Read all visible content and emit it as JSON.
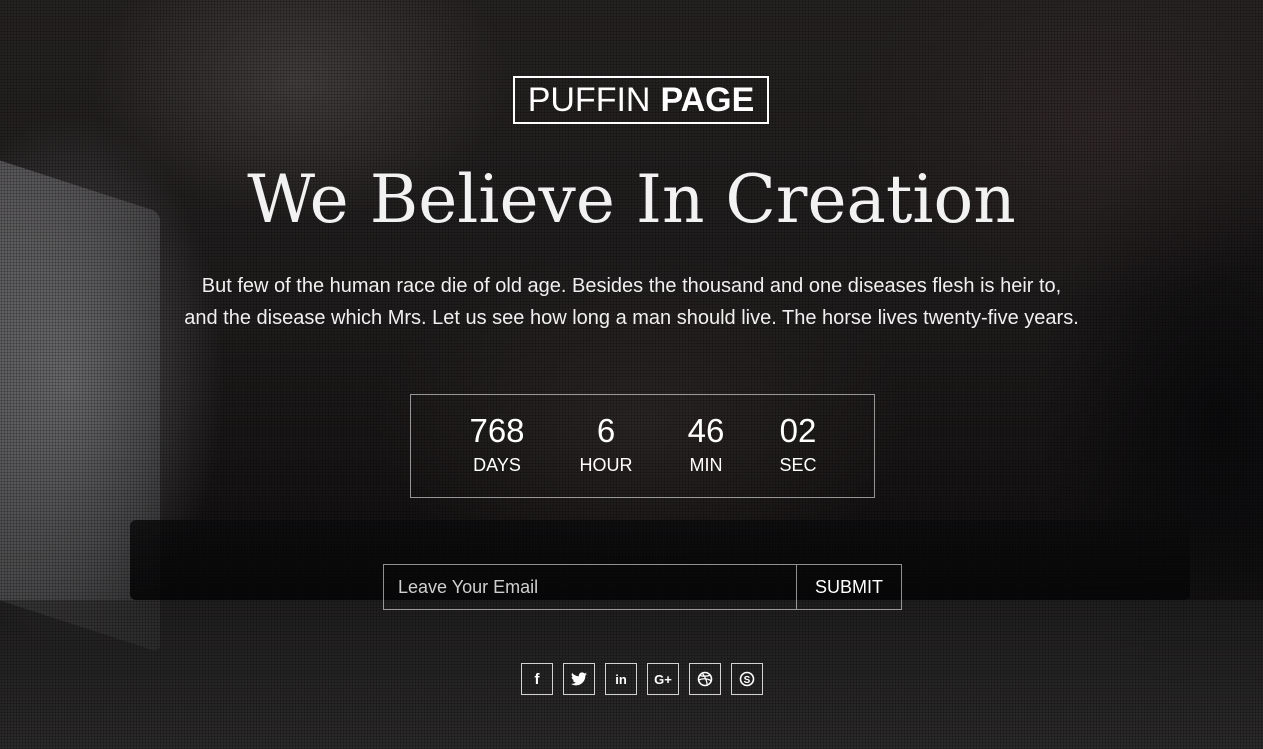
{
  "logo": {
    "light": "PUFFIN",
    "bold": "PAGE"
  },
  "hero": {
    "headline": "We Believe In Creation",
    "description_line1": "But few of the human race die of old age. Besides the thousand and one diseases flesh is heir to,",
    "description_line2": "and the disease which Mrs. Let us see how long a man should live. The horse lives twenty-five years."
  },
  "countdown": {
    "units": [
      {
        "value": "768",
        "label": "DAYS"
      },
      {
        "value": "6",
        "label": "HOUR"
      },
      {
        "value": "46",
        "label": "MIN"
      },
      {
        "value": "02",
        "label": "SEC"
      }
    ]
  },
  "subscribe": {
    "placeholder": "Leave Your Email",
    "button_label": "SUBMIT"
  },
  "social": {
    "icons": [
      "facebook-icon",
      "twitter-icon",
      "linkedin-icon",
      "google-plus-icon",
      "dribbble-icon",
      "skype-icon"
    ],
    "facebook_glyph": "f",
    "linkedin_glyph": "in",
    "googleplus_glyph": "G+"
  }
}
